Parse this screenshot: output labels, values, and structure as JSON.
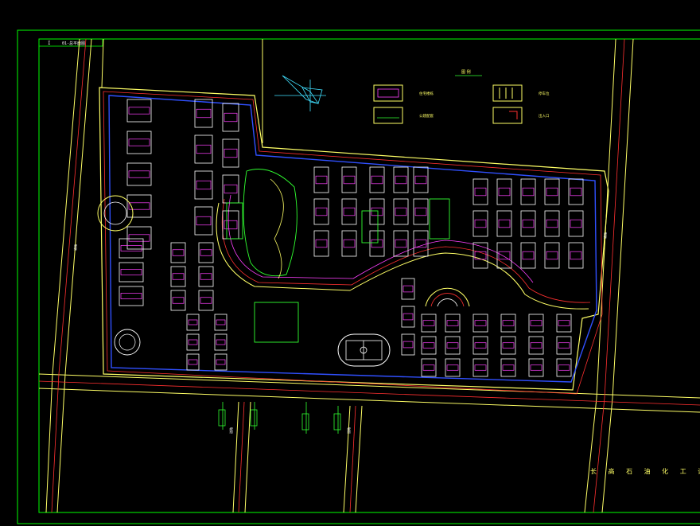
{
  "drawing": {
    "title_block_tag": "I",
    "title_block_code": "01-总平面图",
    "legend_heading": "图 例",
    "legend_items": [
      {
        "label": "住宅楼栋"
      },
      {
        "label": "公建配套"
      },
      {
        "label": "停车位"
      },
      {
        "label": "出入口"
      }
    ],
    "vertical_title": "长 高 石 油 化 工 设 计 院",
    "road_labels": [
      "道路",
      "道路",
      "道路",
      "道路"
    ]
  },
  "colors": {
    "background": "#000000",
    "frame": "#00ff00",
    "road": "#ffff66",
    "redline": "#ff3030",
    "building": "#ffffff",
    "magenta": "#ff40ff",
    "blue": "#3050ff",
    "green": "#30ff30",
    "cyan": "#40e0ff"
  },
  "icons": [
    "north-arrow-icon"
  ]
}
